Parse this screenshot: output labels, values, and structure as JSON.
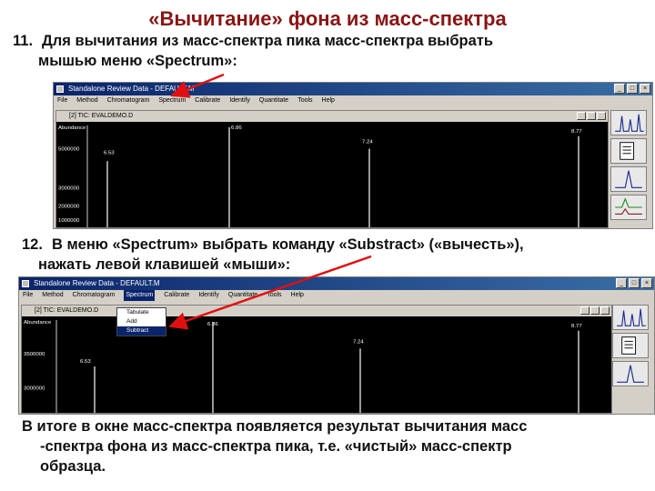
{
  "slide": {
    "title": "«Вычитание» фона из масс-спектра",
    "step11": {
      "num": "11.",
      "line1": "Для вычитания из масс-спектра пика масс-спектра выбрать",
      "line2": "мышью меню «Spectrum»:"
    },
    "step12": {
      "num": "12.",
      "line1": "В меню «Spectrum» выбрать команду «Substract» («вычесть»),",
      "line2": "нажать левой клавишей «мыши»:"
    },
    "result": {
      "line1": "В итоге в окне масс-спектра появляется результат вычитания масс",
      "line2": "-спектра фона из масс-спектра пика, т.е. «чистый» масс-спектр",
      "line3": "образца."
    }
  },
  "screenshot1": {
    "window_title": "Standalone Review Data - DEFAULT.M",
    "menu": [
      "File",
      "Method",
      "Chromatogram",
      "Spectrum",
      "Calibrate",
      "Identify",
      "Quantitate",
      "Tools",
      "Help"
    ],
    "plot_title": "[2] TIC: EVALDEMO.D",
    "y_label": "Abundance",
    "y_ticks": [
      "5000000",
      "3000000",
      "2000000",
      "1000000"
    ],
    "peak_labels": [
      "6.53",
      "6.86",
      "7.24",
      "8.77"
    ]
  },
  "screenshot2": {
    "window_title": "Standalone Review Data - DEFAULT.M",
    "menu": [
      "File",
      "Method",
      "Chromatogram",
      "Spectrum",
      "Calibrate",
      "Identify",
      "Quantitate",
      "Tools",
      "Help"
    ],
    "active_menu": "Spectrum",
    "dropdown": [
      "Tabulate",
      "Add",
      "Subtract"
    ],
    "selected_item": "Subtract",
    "plot_title": "[2] TIC: EVALDEMO.D",
    "y_label": "Abundance",
    "y_ticks": [
      "3500000",
      "3000000"
    ],
    "peak_labels": [
      "6.53",
      "6.86",
      "7.24",
      "8.77"
    ]
  },
  "colors": {
    "title": "#8a1414",
    "arrow": "#e01010",
    "titlebar": "#0a246a"
  }
}
